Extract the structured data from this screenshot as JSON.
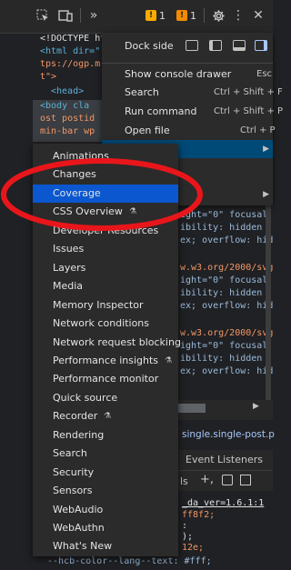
{
  "toolbar": {
    "warnings_count": "1",
    "errors_count": "1"
  },
  "code_lines": [
    "<!DOCTYPE ht",
    "<html dir=\"",
    "tps://ogp.m",
    "t\">",
    "<head>",
    "<body cla",
    "ost postid",
    "min-bar wp"
  ],
  "right_code_lines": [
    "ight=\"0\" focusal",
    "ibility: hidden",
    "ex; overflow: hid",
    "w.w3.org/2000/svg",
    "ight=\"0\" focusal",
    "ibility: hidden",
    "ex; overflow: hid",
    "w.w3.org/2000/svg",
    "ight=\"0\" focusal",
    "ibility: hidden",
    "ex; overflow: hid"
  ],
  "breadcrumb_text": "single.single-post.p",
  "panel_tab": "Event Listeners",
  "styles_line": "ls",
  "css_lines": [
    "_da_ver=1.6.1:1",
    "ff8f2;",
    ":",
    ");",
    "12e;",
    "--hcb-color--lang--text: #fff;"
  ],
  "menu": {
    "dock_side_label": "Dock side",
    "items": [
      {
        "label": "Show console drawer",
        "shortcut": "Esc"
      },
      {
        "label": "Search",
        "shortcut": "Ctrl + Shift + F"
      },
      {
        "label": "Run command",
        "shortcut": "Ctrl + Shift + P"
      },
      {
        "label": "Open file",
        "shortcut": "Ctrl + P"
      }
    ]
  },
  "submenu": {
    "items": [
      {
        "label": "Animations",
        "experimental": false
      },
      {
        "label": "Changes",
        "experimental": false
      },
      {
        "label": "Coverage",
        "experimental": false,
        "selected": true
      },
      {
        "label": "CSS Overview",
        "experimental": true
      },
      {
        "label": "Developer Resources",
        "experimental": false
      },
      {
        "label": "Issues",
        "experimental": false
      },
      {
        "label": "Layers",
        "experimental": false
      },
      {
        "label": "Media",
        "experimental": false
      },
      {
        "label": "Memory Inspector",
        "experimental": false
      },
      {
        "label": "Network conditions",
        "experimental": false
      },
      {
        "label": "Network request blocking",
        "experimental": false
      },
      {
        "label": "Performance insights",
        "experimental": true
      },
      {
        "label": "Performance monitor",
        "experimental": false
      },
      {
        "label": "Quick source",
        "experimental": false
      },
      {
        "label": "Recorder",
        "experimental": true
      },
      {
        "label": "Rendering",
        "experimental": false
      },
      {
        "label": "Search",
        "experimental": false
      },
      {
        "label": "Security",
        "experimental": false
      },
      {
        "label": "Sensors",
        "experimental": false
      },
      {
        "label": "WebAudio",
        "experimental": false
      },
      {
        "label": "WebAuthn",
        "experimental": false
      },
      {
        "label": "What's New",
        "experimental": false
      }
    ]
  },
  "colors": {
    "selected_blue": "#0b57d0",
    "annotation_red": "#e8161b",
    "warning_yellow": "#f9ab00",
    "error_orange": "#f28b00"
  }
}
